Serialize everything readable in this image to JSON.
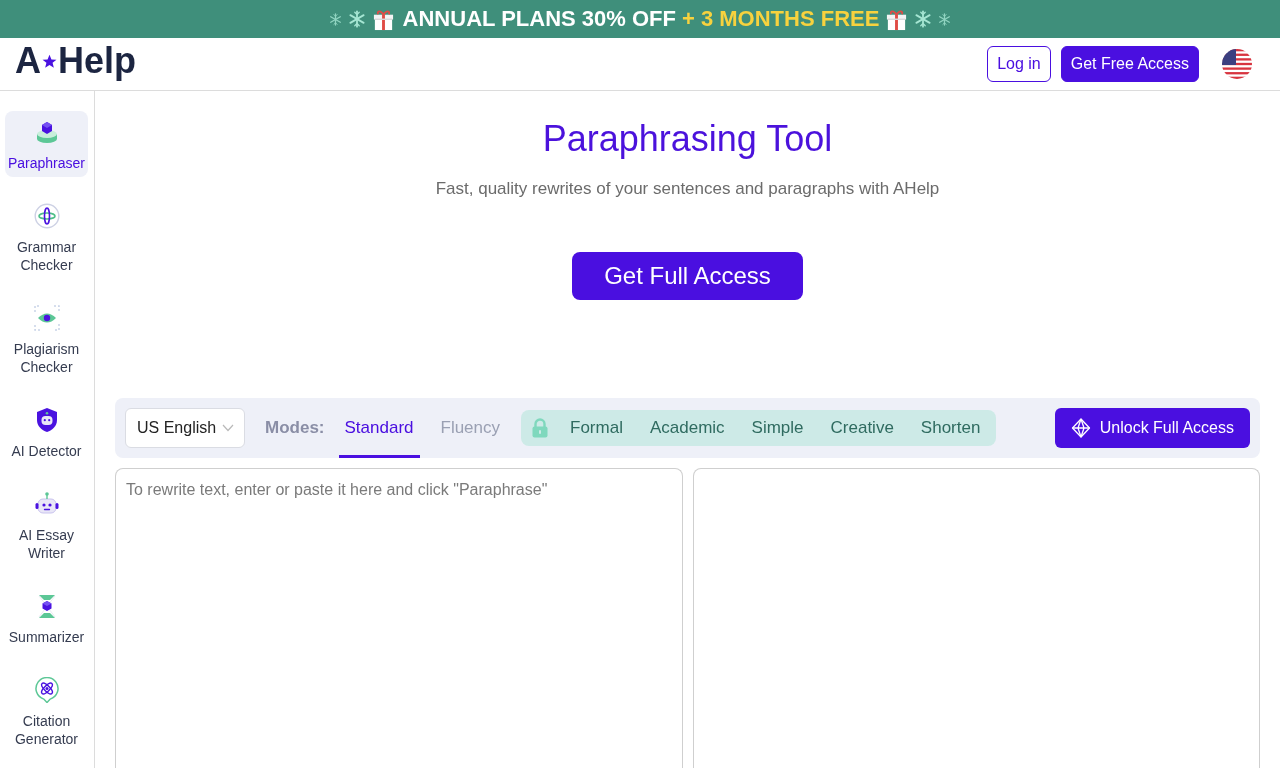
{
  "promo_banner": {
    "text": "ANNUAL PLANS 30% OFF",
    "highlight": "+ 3 MONTHS FREE"
  },
  "header": {
    "logo": {
      "text_left": "A",
      "text_right": "Help"
    },
    "buttons": [
      {
        "label": "Log in",
        "kind": "outline"
      },
      {
        "label": "Get Free Access",
        "kind": "filled"
      }
    ]
  },
  "sidebar": {
    "items": [
      {
        "label": "Paraphraser",
        "kind": "paraphraser",
        "selected": true
      },
      {
        "label": "Grammar Checker",
        "kind": "grammar",
        "selected": false
      },
      {
        "label": "Plagiarism Checker",
        "kind": "plagiarism",
        "selected": false
      },
      {
        "label": "AI Detector",
        "kind": "detector",
        "selected": false
      },
      {
        "label": "AI Essay Writer",
        "kind": "writer",
        "selected": false
      },
      {
        "label": "Summarizer",
        "kind": "summarizer",
        "selected": false
      },
      {
        "label": "Citation Generator",
        "kind": "citation",
        "selected": false
      }
    ]
  },
  "hero": {
    "title": "Paraphrasing Tool",
    "subtitle": "Fast, quality rewrites of your sentences and paragraphs with AHelp",
    "button": "Get Full Access"
  },
  "toolbar": {
    "language": "US English",
    "modes_label": "Modes:",
    "modes": [
      {
        "label": "Standard",
        "selected": true,
        "locked": false
      },
      {
        "label": "Fluency",
        "selected": false,
        "locked": false
      },
      {
        "label": "Formal",
        "selected": false,
        "locked": true
      },
      {
        "label": "Academic",
        "selected": false,
        "locked": true
      },
      {
        "label": "Simple",
        "selected": false,
        "locked": true
      },
      {
        "label": "Creative",
        "selected": false,
        "locked": true
      },
      {
        "label": "Shorten",
        "selected": false,
        "locked": true
      }
    ],
    "unlock_button": "Unlock Full Access"
  },
  "input_panel": {
    "placeholder": "To rewrite text, enter or paste it here and click \"Paraphrase\""
  }
}
